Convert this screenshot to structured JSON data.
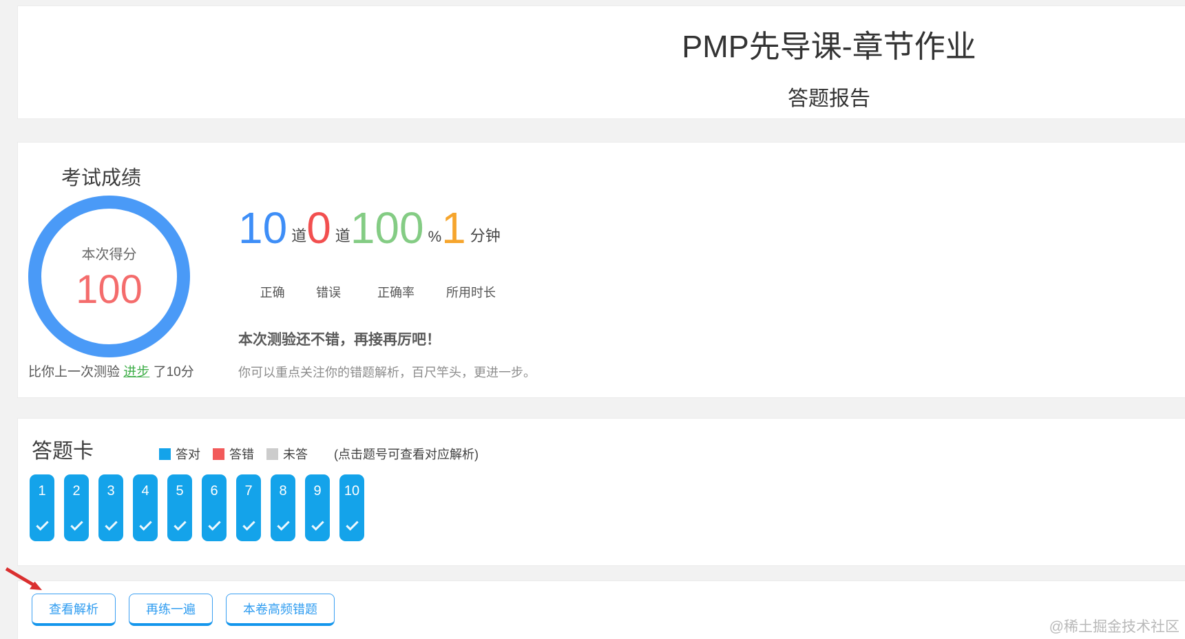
{
  "page": {
    "title": "PMP先导课-章节作业",
    "subtitle": "答题报告",
    "watermark": "@稀土掘金技术社区"
  },
  "score_card": {
    "heading": "考试成绩",
    "gauge": {
      "label": "本次得分",
      "score": "100",
      "ring_color": "#4a9af7",
      "score_color": "#f46c6c"
    },
    "progress_note": {
      "prefix": "比你上一次测验 ",
      "highlight": "进步",
      "suffix": " 了10分",
      "highlight_color": "#3fae49"
    },
    "stats": [
      {
        "value": "10",
        "unit": "道",
        "label": "正确",
        "color": "#3e8ef7"
      },
      {
        "value": "0",
        "unit": "道",
        "label": "错误",
        "color": "#f24f4f"
      },
      {
        "value": "100",
        "unit": "%",
        "label": "正确率",
        "color": "#84cc84"
      },
      {
        "value": "1",
        "unit": "分钟",
        "label": "所用时长",
        "color": "#f6a52d"
      }
    ],
    "message_bold": "本次测验还不错，再接再厉吧！",
    "message_sub": "你可以重点关注你的错题解析，百尺竿头，更进一步。"
  },
  "answer_card": {
    "heading": "答题卡",
    "legend": [
      {
        "label": "答对",
        "color": "#14a3ea"
      },
      {
        "label": "答错",
        "color": "#f25a5a"
      },
      {
        "label": "未答",
        "color": "#cccccc"
      }
    ],
    "legend_note": "(点击题号可查看对应解析)",
    "questions": [
      {
        "num": "1",
        "status": "correct"
      },
      {
        "num": "2",
        "status": "correct"
      },
      {
        "num": "3",
        "status": "correct"
      },
      {
        "num": "4",
        "status": "correct"
      },
      {
        "num": "5",
        "status": "correct"
      },
      {
        "num": "6",
        "status": "correct"
      },
      {
        "num": "7",
        "status": "correct"
      },
      {
        "num": "8",
        "status": "correct"
      },
      {
        "num": "9",
        "status": "correct"
      },
      {
        "num": "10",
        "status": "correct"
      }
    ]
  },
  "footer": {
    "buttons": [
      "查看解析",
      "再练一遍",
      "本卷高频错题"
    ]
  }
}
